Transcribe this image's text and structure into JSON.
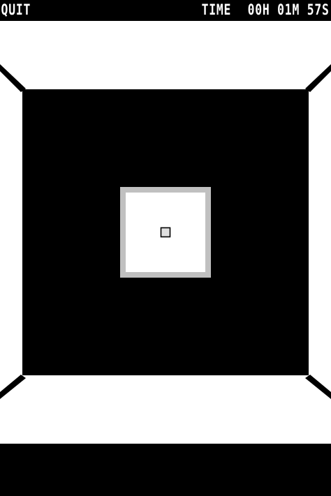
{
  "header": {
    "quit_label": "QUIT",
    "time_label": "TIME",
    "time_value": "00H 01M 57S"
  },
  "colors": {
    "background": "#000000",
    "wall": "#ffffff",
    "frame": "#c0c0c0",
    "text": "#ffffff"
  }
}
